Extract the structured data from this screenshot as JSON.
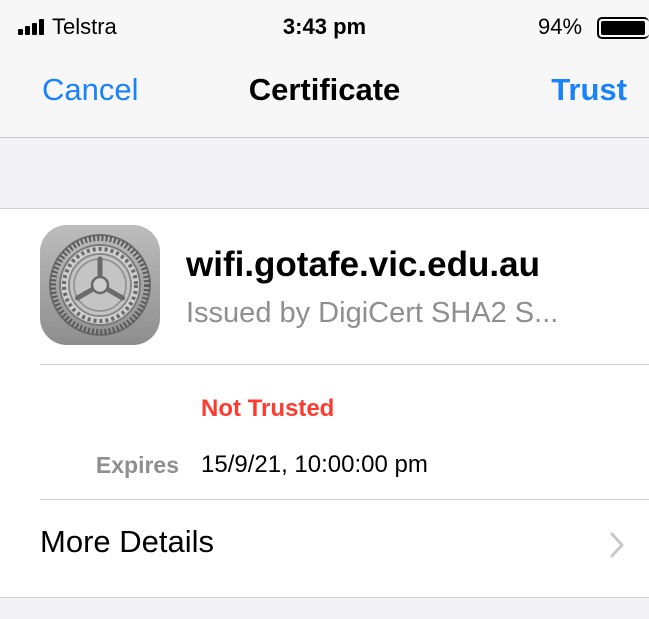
{
  "status_bar": {
    "carrier": "Telstra",
    "time": "3:43 pm",
    "battery_percent": "94%",
    "battery_level": 0.94,
    "icons": [
      "signal-bars-icon",
      "battery-icon"
    ]
  },
  "nav": {
    "cancel_label": "Cancel",
    "title": "Certificate",
    "trust_label": "Trust"
  },
  "certificate": {
    "name": "wifi.gotafe.vic.edu.au",
    "issuer": "Issued by DigiCert SHA2 S...",
    "icon": "settings-gear-icon",
    "status": "Not Trusted",
    "expires_label": "Expires",
    "expires_value": "15/9/21, 10:00:00 pm"
  },
  "more_details": {
    "label": "More Details",
    "icon": "chevron-right-icon"
  },
  "colors": {
    "accent": "#1a82fb",
    "danger": "#ff3b30",
    "secondary_text": "#8e8e93",
    "background": "#f2f2f7"
  }
}
